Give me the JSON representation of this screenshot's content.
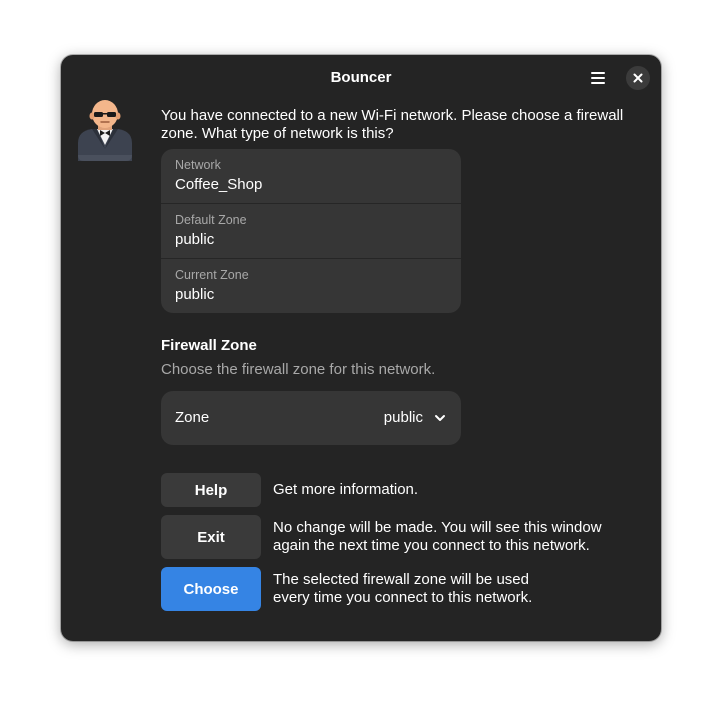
{
  "window": {
    "title": "Bouncer",
    "menu_icon": "hamburger-menu-icon",
    "close_icon": "close-icon"
  },
  "avatar": {
    "icon": "bouncer-avatar-icon"
  },
  "intro": {
    "text": "You have connected to a new Wi-Fi network. Please choose a firewall zone. What type of network is this?"
  },
  "info": {
    "rows": [
      {
        "label": "Network",
        "value": "Coffee_Shop"
      },
      {
        "label": "Default Zone",
        "value": "public"
      },
      {
        "label": "Current Zone",
        "value": "public"
      }
    ]
  },
  "firewall": {
    "title": "Firewall Zone",
    "subtitle": "Choose the firewall zone for this network.",
    "zone_label": "Zone",
    "zone_value": "public"
  },
  "actions": {
    "help": {
      "label": "Help",
      "desc": "Get more information."
    },
    "exit": {
      "label": "Exit",
      "desc": "No change will be made. You will see this window again the next time you connect to this network."
    },
    "choose": {
      "label": "Choose",
      "desc": "The selected firewall zone will be used every time you connect to this network."
    }
  },
  "colors": {
    "window_bg": "#242424",
    "card_bg": "#363636",
    "button_bg": "#3a3a3a",
    "accent": "#3584e4",
    "dim_text": "#a8a8a8"
  }
}
